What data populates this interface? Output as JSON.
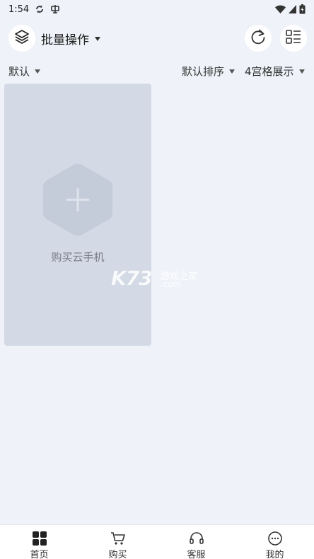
{
  "status_bar": {
    "time": "1:54"
  },
  "header": {
    "title": "批量操作"
  },
  "filters": {
    "default_label": "默认",
    "sort_label": "默认排序",
    "grid_label": "4宫格展示"
  },
  "card": {
    "label": "购买云手机"
  },
  "watermark": {
    "logo": "K73",
    "site": "游戏之家",
    "domain": ".com"
  },
  "tabs": [
    {
      "label": "首页",
      "icon": "grid-icon"
    },
    {
      "label": "购买",
      "icon": "cart-icon"
    },
    {
      "label": "客服",
      "icon": "headset-icon"
    },
    {
      "label": "我的",
      "icon": "chat-icon"
    }
  ],
  "colors": {
    "background": "#eff2f8",
    "card": "#d3d9e5",
    "hexagon": "#c5ccd9"
  }
}
